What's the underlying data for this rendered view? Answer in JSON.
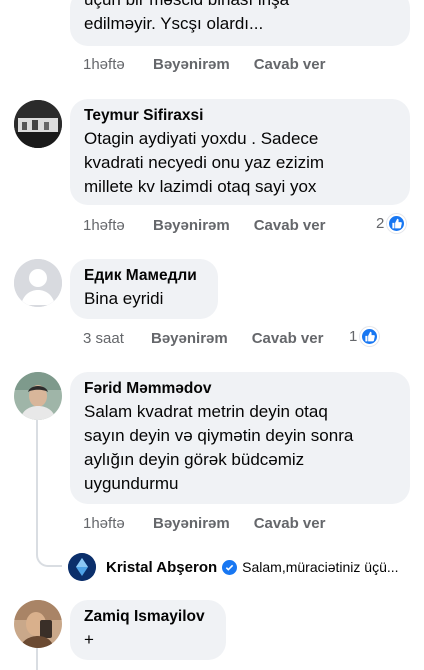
{
  "comments": [
    {
      "text": "uçun bir məscid binası inşa\nedilməyir. Yscşı olardı...",
      "time": "1həftə",
      "like_label": "Bəyənirəm",
      "reply_label": "Cavab ver"
    },
    {
      "author": "Teymur Sifiraxsi",
      "text": "Otagin aydiyati yoxdu . Sadece\nkvadrati necyedi onu yaz ezizim\nmillete kv lazimdi  otaq sayi yox",
      "time": "1həftə",
      "like_label": "Bəyənirəm",
      "reply_label": "Cavab ver",
      "reactions": "2",
      "reaction_icon": "like-icon"
    },
    {
      "author": "Едик Мамедли",
      "text": "Bina eyridi",
      "time": "3 saat",
      "like_label": "Bəyənirəm",
      "reply_label": "Cavab ver",
      "reactions": "1",
      "reaction_icon": "like-icon"
    },
    {
      "author": "Fərid Məmmədov",
      "text": "Salam kvadrat metrin deyin otaq\nsayın deyin və qiymətin deyin sonra\naylığın deyin görək büdcəmiz\nuygundurmu",
      "time": "1həftə",
      "like_label": "Bəyənirəm",
      "reply_label": "Cavab ver"
    },
    {
      "author": "Zamiq Ismayilov",
      "text": "+"
    }
  ],
  "reply_preview": {
    "author": "Kristal Abşeron",
    "verified_icon": "verified-badge-icon",
    "text": "Salam,müraciətiniz üçü..."
  },
  "colors": {
    "bubble": "#f0f2f5",
    "meta_text": "#65676b",
    "like_blue": "#1877f2",
    "thread_line": "#d9dde2"
  }
}
